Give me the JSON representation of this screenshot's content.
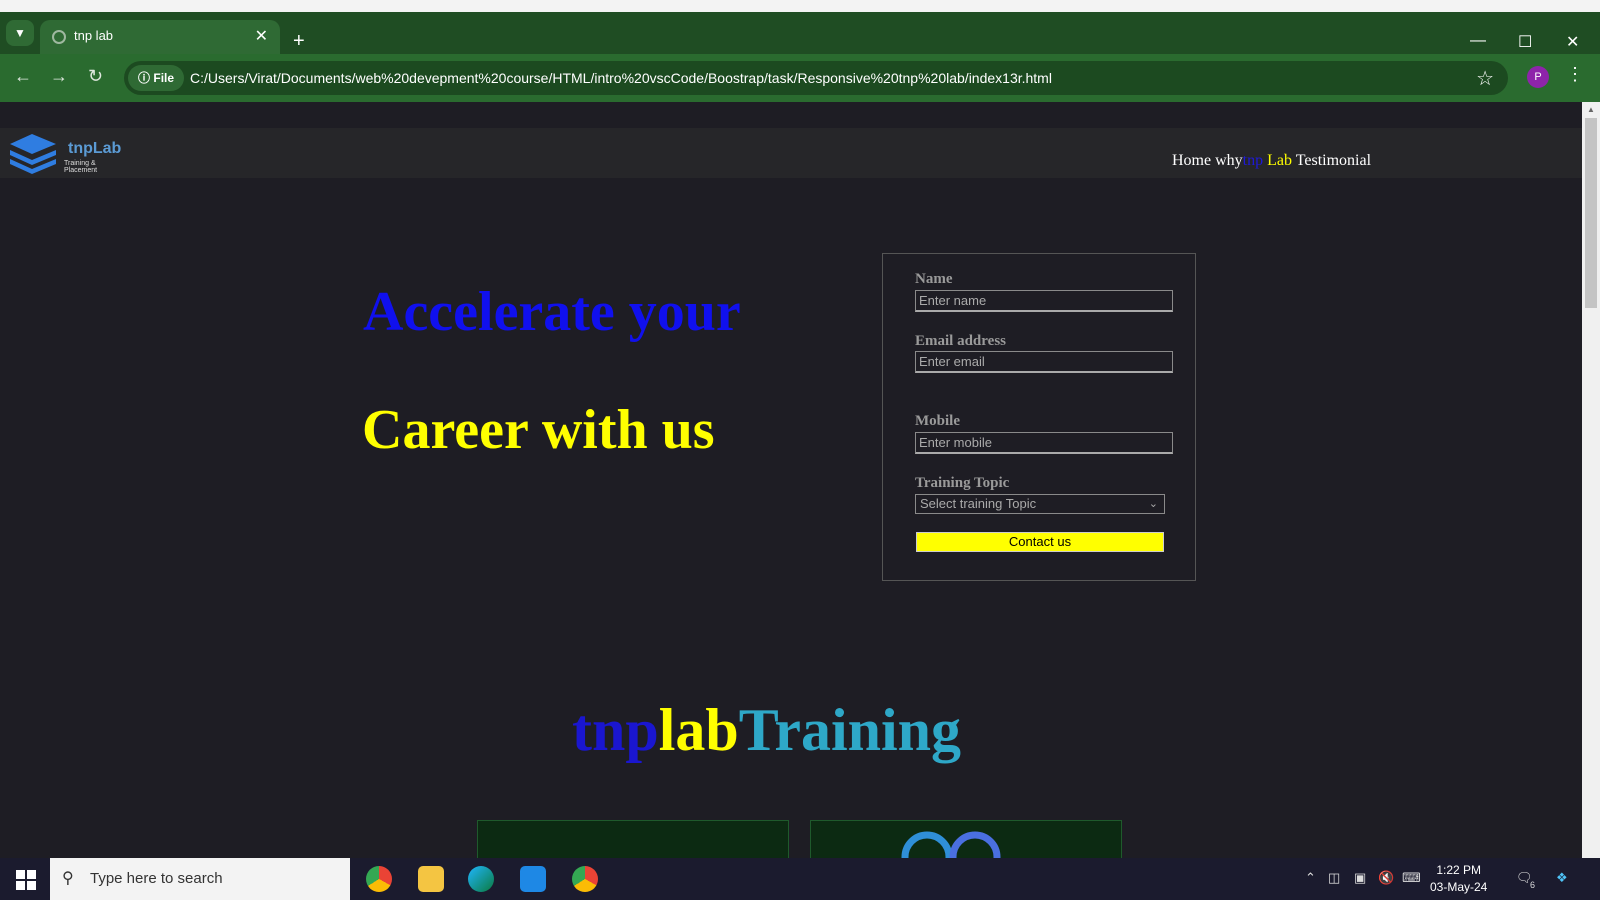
{
  "browser": {
    "tab_title": "tnp lab",
    "file_chip": "File",
    "url": "C:/Users/Virat/Documents/web%20devepment%20course/HTML/intro%20vscCode/Boostrap/task/Responsive%20tnp%20lab/index13r.html",
    "profile_initial": "P"
  },
  "navbar": {
    "brand": "tnpLab",
    "brand_sub": "Training & Placement",
    "links": {
      "home": "Home",
      "why": "why",
      "tnp": "tnp",
      "lab": "Lab",
      "testimonial": "Testimonial"
    }
  },
  "hero": {
    "line1": "Accelerate your",
    "line2": "Career with us"
  },
  "form": {
    "name_label": "Name",
    "name_placeholder": "Enter name",
    "email_label": "Email address",
    "email_placeholder": "Enter email",
    "mobile_label": "Mobile",
    "mobile_placeholder": "Enter mobile",
    "topic_label": "Training Topic",
    "topic_selected": "Select training Topic",
    "submit_label": "Contact us"
  },
  "section": {
    "part1": "tnp",
    "part2": "lab",
    "part3": "Training"
  },
  "taskbar": {
    "search_placeholder": "Type here to search",
    "time": "1:22 PM",
    "date": "03-May-24",
    "notification_count": "6"
  },
  "colors": {
    "hero_blue": "#1010ee",
    "hero_yellow": "#ffff00",
    "section_cyan": "#2ea8c8",
    "browser_green": "#2a6b2f"
  }
}
